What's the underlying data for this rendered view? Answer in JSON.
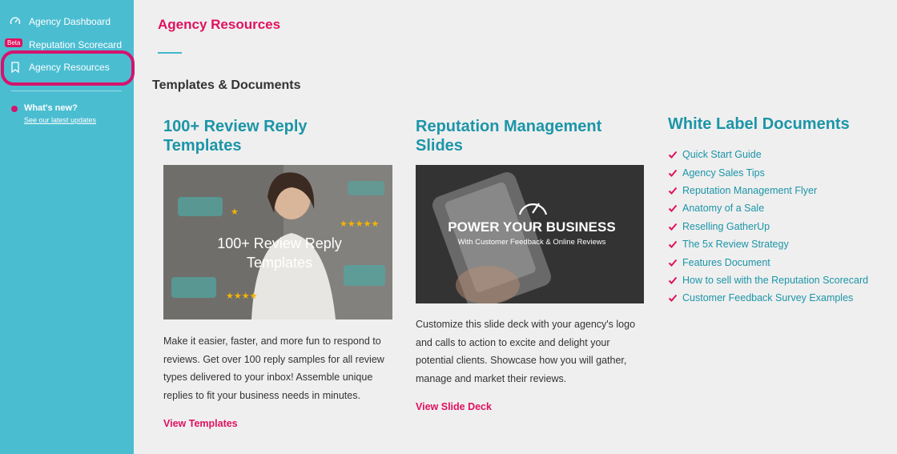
{
  "sidebar": {
    "items": [
      {
        "label": "Agency Dashboard",
        "icon": "gauge-icon"
      },
      {
        "label": "Reputation Scorecard",
        "badge": "Beta"
      },
      {
        "label": "Agency Resources",
        "icon": "bookmark-icon"
      }
    ],
    "whats_new": {
      "title": "What's new?",
      "link": "See our latest updates"
    },
    "colors": {
      "background": "#4bbdd1",
      "highlight": "#d4146d"
    }
  },
  "main": {
    "page_title": "Agency Resources",
    "section_title": "Templates & Documents",
    "columns": [
      {
        "title": "100+ Review Reply Templates",
        "image_text": "100+ Review Reply Templates",
        "description": "Make it easier, faster, and more fun to respond to reviews. Get over 100 reply samples for all review types delivered to your inbox! Assemble unique replies to fit your business needs in minutes.",
        "cta": "View Templates"
      },
      {
        "title": "Reputation Management Slides",
        "image_title": "POWER YOUR BUSINESS",
        "image_subtitle": "With Customer Feedback & Online Reviews",
        "description": "Customize this slide deck with your agency's logo and calls to action to excite and delight your potential clients. Showcase how you will gather, manage and market their reviews.",
        "cta": "View Slide Deck"
      },
      {
        "title": "White Label Documents",
        "documents": [
          "Quick Start Guide",
          "Agency Sales Tips",
          "Reputation Management Flyer",
          "Anatomy of a Sale",
          "Reselling GatherUp",
          "The 5x Review Strategy",
          "Features Document",
          "How to sell with the Reputation Scorecard",
          "Customer Feedback Survey Examples"
        ]
      }
    ],
    "colors": {
      "accent": "#e0115f",
      "teal": "#1c95a8"
    }
  }
}
